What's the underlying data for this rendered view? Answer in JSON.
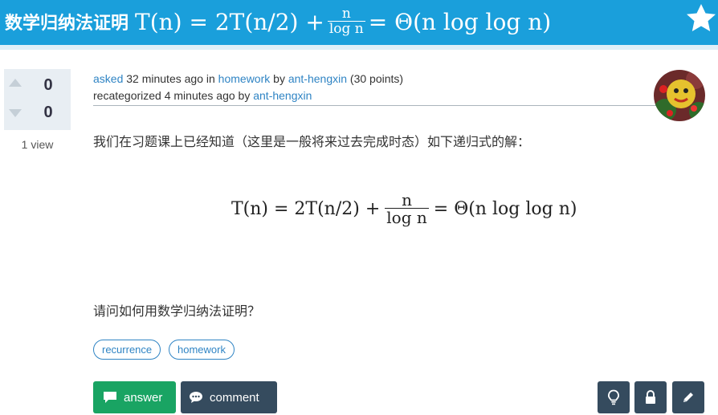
{
  "question": {
    "title_cn": "数学归纳法证明",
    "title_formula": {
      "lhs": "T(n) = 2T(n/2) +",
      "frac_num": "n",
      "frac_den": "log n",
      "rhs": "= Θ(n log log n)"
    }
  },
  "vote": {
    "up_count": "0",
    "down_count": "0",
    "views": "1 view"
  },
  "meta": {
    "line1": {
      "asked": "asked",
      "time": "32 minutes ago",
      "in": "in",
      "category": "homework",
      "by": "by",
      "user": "ant-hengxin",
      "points": "(30 points)"
    },
    "line2": {
      "action": "recategorized 4 minutes ago by",
      "user": "ant-hengxin"
    }
  },
  "body": {
    "para1": "我们在习题课上已经知道（这里是一般将来过去完成时态）如下递归式的解：",
    "formula": {
      "lhs": "T(n) = 2T(n/2) +",
      "frac_num": "n",
      "frac_den": "log n",
      "rhs": "= Θ(n log log n)"
    },
    "para2": "请问如何用数学归纳法证明？"
  },
  "tags": [
    "recurrence",
    "homework"
  ],
  "actions": {
    "answer_label": "answer",
    "comment_label": "comment",
    "tools": [
      "lightbulb-icon",
      "lock-icon",
      "pencil-icon"
    ]
  },
  "colors": {
    "title_bar": "#1a9fdb",
    "link": "#2f84c4",
    "answer_button": "#19a463",
    "dark_button": "#354b5e"
  }
}
